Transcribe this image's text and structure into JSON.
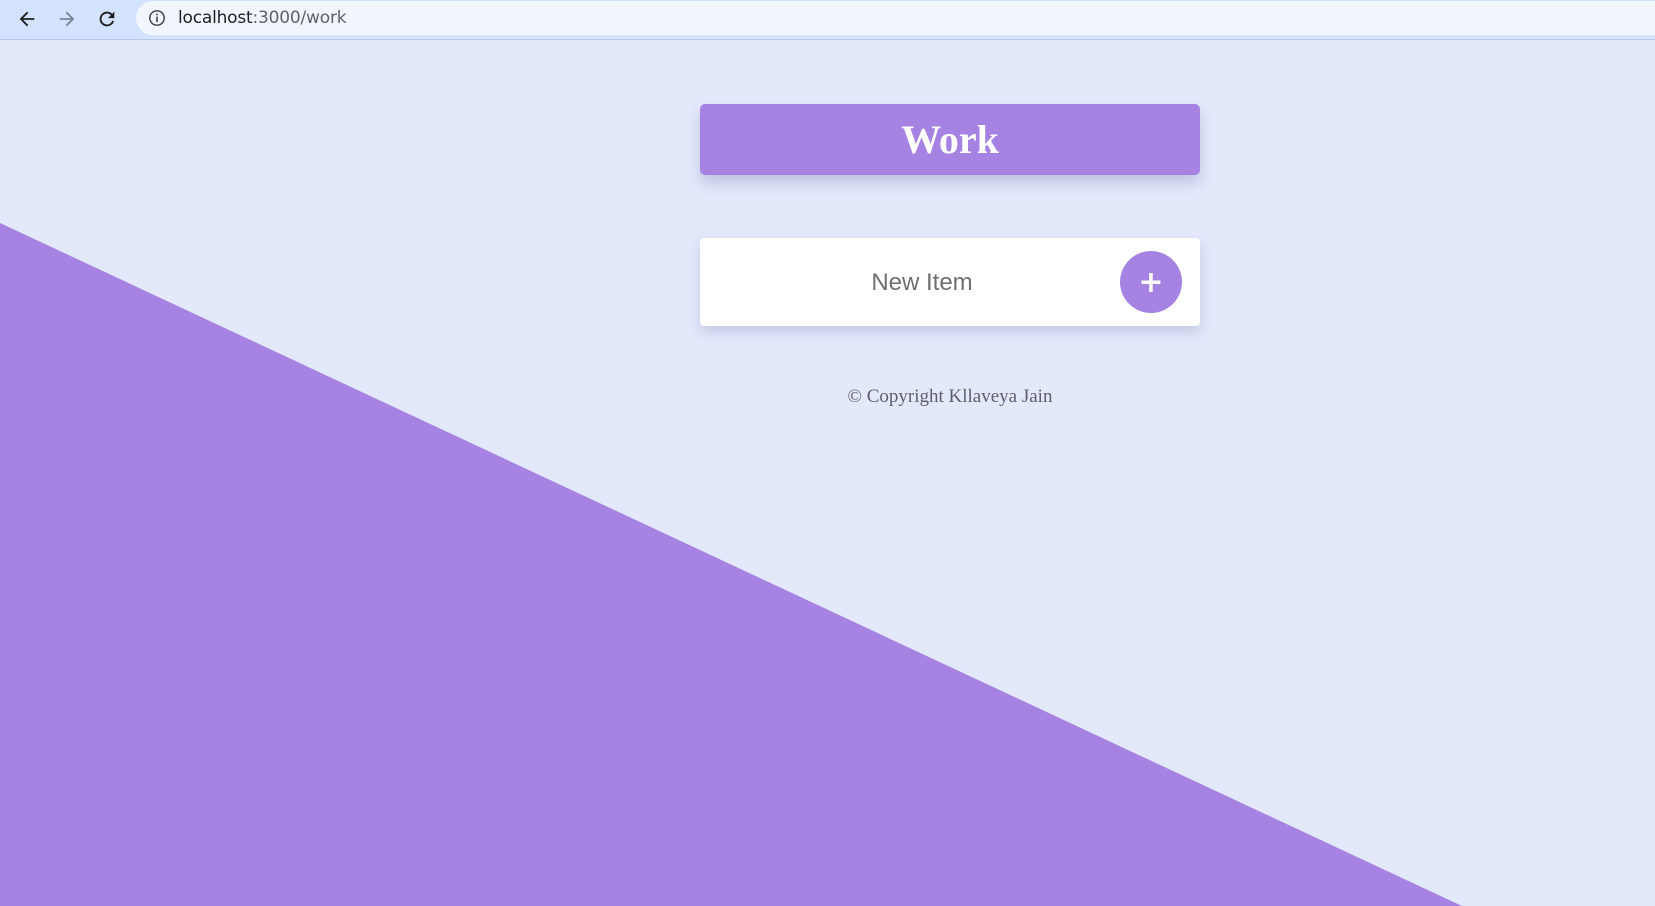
{
  "browser": {
    "url_host": "localhost",
    "url_path": ":3000/work"
  },
  "page": {
    "title": "Work",
    "new_item_placeholder": "New Item",
    "add_button_label": "+",
    "footer": "© Copyright Kllaveya Jain"
  },
  "colors": {
    "background": "#E3E8FB",
    "accent": "#A683E3",
    "card": "#FFFFFF"
  },
  "icons": {
    "back": "arrow-left-icon",
    "forward": "arrow-right-icon",
    "reload": "reload-icon",
    "site_info": "info-icon"
  }
}
